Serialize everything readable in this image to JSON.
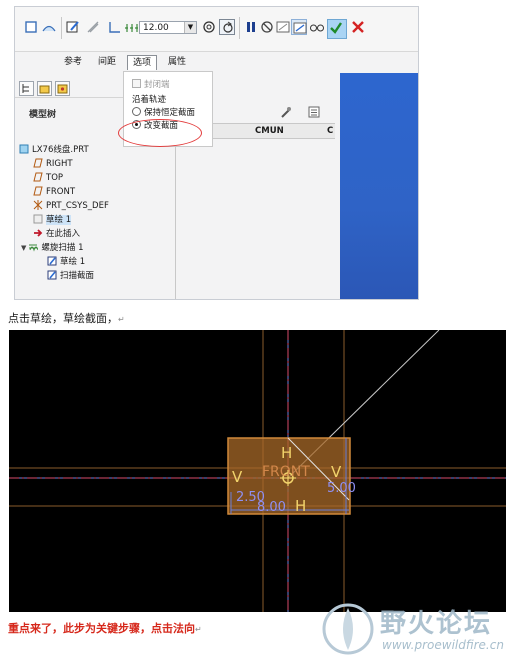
{
  "toolbar": {
    "thickness_value": "12.00",
    "icons": [
      "solid-icon",
      "surface-icon",
      "sketch-edit-icon",
      "remove-material-icon",
      "thicken-icon",
      "thicken-option-icon",
      "helix-icon",
      "direction-icon",
      "pause-icon",
      "no-preview-icon",
      "attached-preview-icon",
      "live-preview-icon",
      "glasses-icon",
      "confirm-icon",
      "cancel-icon"
    ]
  },
  "tabs": [
    "参考",
    "间距",
    "选项",
    "属性"
  ],
  "options_panel": {
    "end_condition": "封闭端",
    "group_label": "沿着轨迹",
    "radio_keep": "保持恒定截面",
    "radio_change": "改变截面"
  },
  "model_tree": {
    "label": "模型树",
    "columns": [
      "E",
      "CMUN",
      "C"
    ],
    "items": [
      {
        "label": "LX76线盘.PRT",
        "icon": "part-icon"
      },
      {
        "label": "RIGHT",
        "icon": "datum-plane-icon"
      },
      {
        "label": "TOP",
        "icon": "datum-plane-icon"
      },
      {
        "label": "FRONT",
        "icon": "datum-plane-icon"
      },
      {
        "label": "PRT_CSYS_DEF",
        "icon": "csys-icon"
      },
      {
        "label": "草绘 1",
        "icon": "sketch-icon"
      },
      {
        "label": "在此插入",
        "icon": "insert-here-icon"
      },
      {
        "label": "螺旋扫描 1",
        "icon": "helical-sweep-icon"
      },
      {
        "label": "草绘 1",
        "icon": "sketch-icon"
      },
      {
        "label": "扫描截面",
        "icon": "sketch-icon"
      }
    ]
  },
  "captions": {
    "first": "点击草绘，草绘截面，",
    "second": "重点来了，此步为关键步骤，点击法向"
  },
  "sketch": {
    "label_h_top": "H",
    "label_h_bottom": "H",
    "label_v_left": "V",
    "label_v_right": "V",
    "label_front": "FRONT",
    "dim_left": "2.50",
    "dim_bottom": "8.00",
    "dim_right": "5.00"
  },
  "watermark": {
    "text": "野火论坛",
    "url": "www.proewildfire.cn"
  }
}
